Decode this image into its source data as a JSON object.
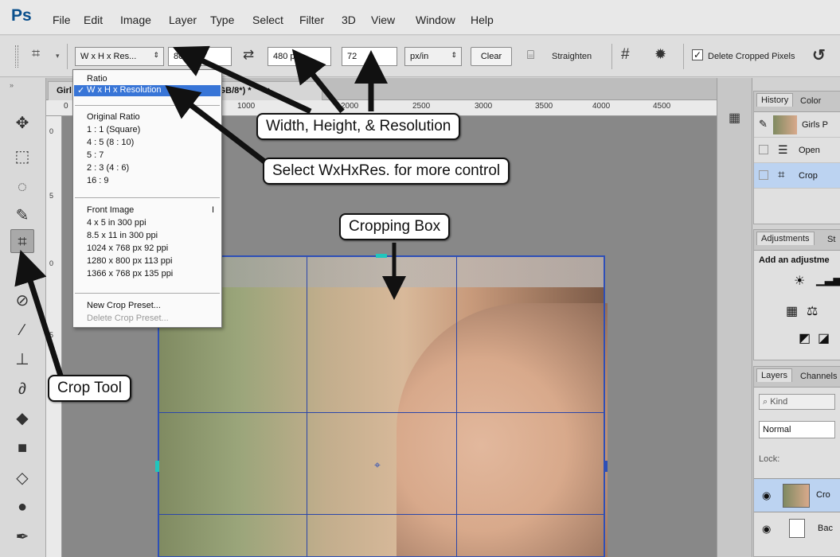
{
  "app": {
    "logo": "Ps",
    "menu": [
      "File",
      "Edit",
      "Image",
      "Layer",
      "Type",
      "Select",
      "Filter",
      "3D",
      "View",
      "Window",
      "Help"
    ]
  },
  "options_bar": {
    "preset_label": "W x H x Res...",
    "width_value": "800 px",
    "height_value": "480 px",
    "resolution_value": "72",
    "resolution_unit": "px/in",
    "clear_label": "Clear",
    "straighten_label": "Straighten",
    "delete_cropped_label": "Delete Cropped Pixels"
  },
  "document": {
    "tab_title": "Girl",
    "tab_title_rest": "eview, RGB/8*) *",
    "tab_close": "×"
  },
  "ruler": {
    "top_ticks": [
      "0",
      "1000",
      "2000",
      "2500",
      "3000",
      "3500",
      "4000",
      "4500"
    ],
    "left_ticks": [
      "0",
      "5",
      "0",
      "5"
    ]
  },
  "dropdown": {
    "items": [
      "Ratio",
      "W x H x Resolution",
      "Original Ratio",
      "1 : 1 (Square)",
      "4 : 5 (8 : 10)",
      "5 : 7",
      "2 : 3 (4 : 6)",
      "16 : 9",
      "Front Image",
      "4 x 5 in 300 ppi",
      "8.5 x 11 in 300 ppi",
      "1024 x 768 px 92 ppi",
      "1280 x 800 px 113 ppi",
      "1366 x 768 px 135 ppi",
      "New Crop Preset...",
      "Delete Crop Preset..."
    ],
    "selected_index": 1,
    "shortcut": "I"
  },
  "callouts": {
    "whr": "Width, Height, & Resolution",
    "select": "Select WxHxRes. for more control",
    "crop_box": "Cropping Box",
    "crop_tool": "Crop Tool"
  },
  "panels": {
    "history_tabs": [
      "History",
      "Color"
    ],
    "history_items": [
      "Girls P",
      "Open",
      "Crop"
    ],
    "adjustments_tabs": [
      "Adjustments",
      "St"
    ],
    "adjustments_title": "Add an adjustme",
    "layers_tabs": [
      "Layers",
      "Channels"
    ],
    "kind_label": "Kind",
    "blend_mode": "Normal",
    "lock_label": "Lock:",
    "layers": [
      "Cro",
      "Bac"
    ]
  }
}
